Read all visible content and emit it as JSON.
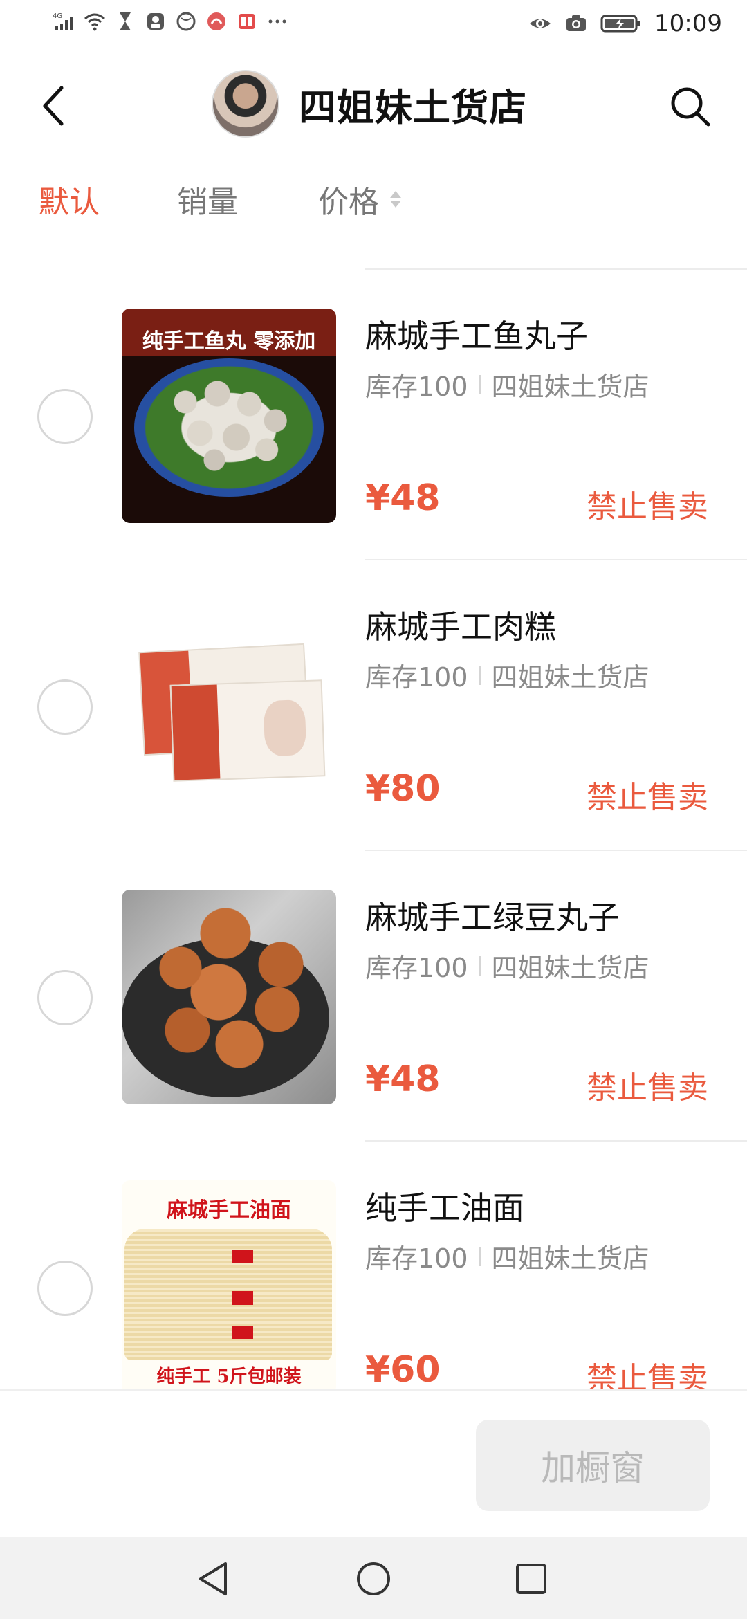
{
  "status_bar": {
    "time": "10:09",
    "left_icons": [
      "signal-4g-icon",
      "wifi-icon",
      "hourglass-icon",
      "app-icon",
      "app-icon",
      "app-icon",
      "app-icon",
      "more-icon"
    ],
    "right_icons": [
      "eye-icon",
      "camera-icon",
      "battery-icon"
    ]
  },
  "header": {
    "store_name": "四姐妹土货店",
    "back_icon": "chevron-left-icon",
    "search_icon": "search-icon"
  },
  "tabs": [
    {
      "label": "默认",
      "active": true
    },
    {
      "label": "销量",
      "active": false
    },
    {
      "label": "价格",
      "active": false
    }
  ],
  "products": [
    {
      "name": "麻城手工鱼丸子",
      "stock": "库存100",
      "store": "四姐妹土货店",
      "price": "¥48",
      "action": "禁止售卖",
      "image_text": "纯手工鱼丸 零添加"
    },
    {
      "name": "麻城手工肉糕",
      "stock": "库存100",
      "store": "四姐妹土货店",
      "price": "¥80",
      "action": "禁止售卖"
    },
    {
      "name": "麻城手工绿豆丸子",
      "stock": "库存100",
      "store": "四姐妹土货店",
      "price": "¥48",
      "action": "禁止售卖"
    },
    {
      "name": "纯手工油面",
      "stock": "库存100",
      "store": "四姐妹土货店",
      "price": "¥60",
      "action": "禁止售卖",
      "image_text": "麻城手工油面",
      "image_subtext": "纯手工 5斤包邮装"
    }
  ],
  "bottom": {
    "add_button": "加橱窗"
  },
  "colors": {
    "accent": "#ea5a3e",
    "muted": "#8a8a8a",
    "disabled_bg": "#efefef",
    "disabled_text": "#b9b9b9"
  }
}
